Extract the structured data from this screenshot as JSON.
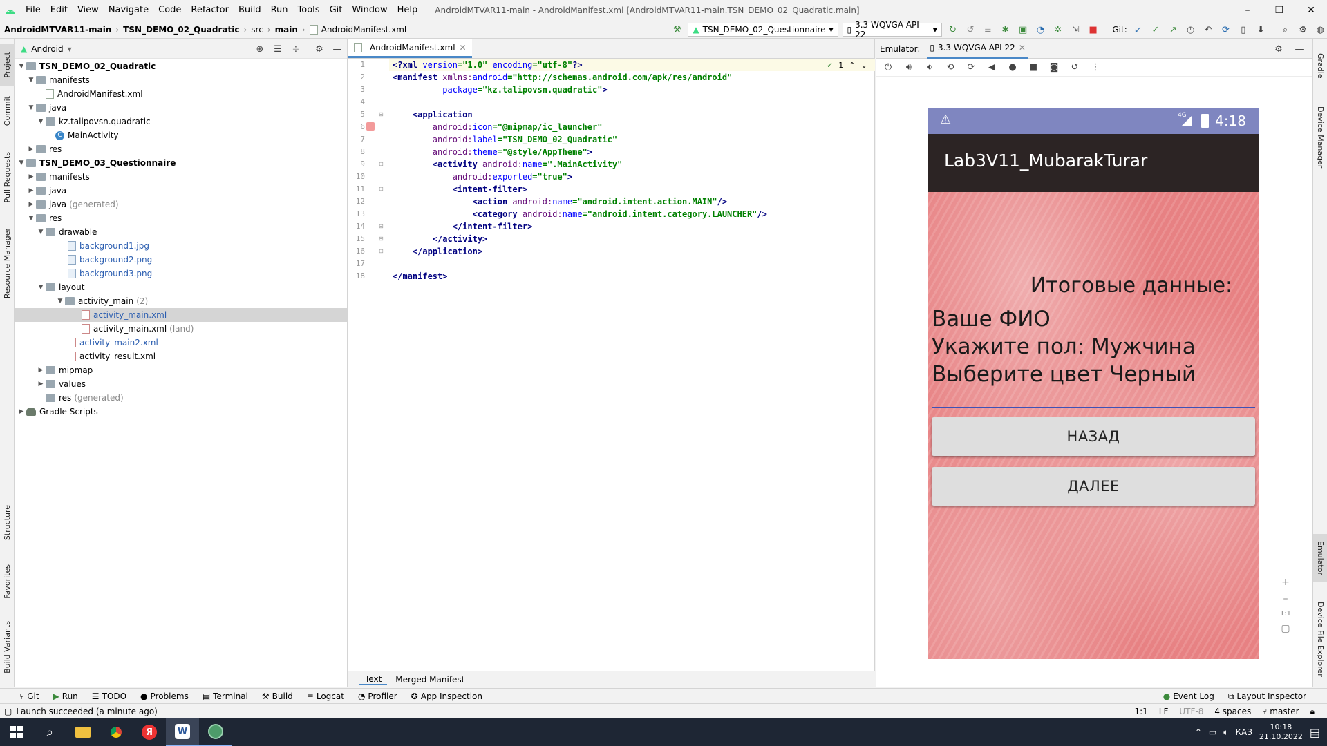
{
  "titlebar": {
    "menu": [
      "File",
      "Edit",
      "View",
      "Navigate",
      "Code",
      "Refactor",
      "Build",
      "Run",
      "Tools",
      "Git",
      "Window",
      "Help"
    ],
    "window_title": "AndroidMTVAR11-main - AndroidManifest.xml [AndroidMTVAR11-main.TSN_DEMO_02_Quadratic.main]",
    "controls": [
      "–",
      "❐",
      "✕"
    ]
  },
  "navbar": {
    "crumbs": [
      "AndroidMTVAR11-main",
      "TSN_DEMO_02_Quadratic",
      "src",
      "main",
      "AndroidManifest.xml"
    ],
    "run_config": "TSN_DEMO_02_Questionnaire",
    "device": "3.3  WQVGA API 22",
    "git_label": "Git:"
  },
  "left_strip": [
    "Project",
    "Commit",
    "Pull Requests",
    "Resource Manager",
    "Structure",
    "Favorites",
    "Build Variants"
  ],
  "right_strip": [
    "Gradle",
    "Device Manager",
    "Emulator",
    "Device File Explorer"
  ],
  "project": {
    "view_mode": "Android",
    "tree": [
      {
        "label": "TSN_DEMO_02_Quadratic",
        "bold": true
      },
      {
        "label": "manifests"
      },
      {
        "label": "AndroidManifest.xml"
      },
      {
        "label": "java"
      },
      {
        "label": "kz.talipovsn.quadratic"
      },
      {
        "label": "MainActivity"
      },
      {
        "label": "res"
      },
      {
        "label": "TSN_DEMO_03_Questionnaire",
        "bold": true
      },
      {
        "label": "manifests"
      },
      {
        "label": "java"
      },
      {
        "label": "java",
        "suffix": "(generated)"
      },
      {
        "label": "res"
      },
      {
        "label": "drawable"
      },
      {
        "label": "background1.jpg"
      },
      {
        "label": "background2.png"
      },
      {
        "label": "background3.png"
      },
      {
        "label": "layout"
      },
      {
        "label": "activity_main",
        "suffix": "(2)"
      },
      {
        "label": "activity_main.xml"
      },
      {
        "label": "activity_main.xml",
        "suffix": "(land)"
      },
      {
        "label": "activity_main2.xml"
      },
      {
        "label": "activity_result.xml"
      },
      {
        "label": "mipmap"
      },
      {
        "label": "values"
      },
      {
        "label": "res",
        "suffix": "(generated)"
      },
      {
        "label": "Gradle Scripts"
      }
    ]
  },
  "editor": {
    "tab": "AndroidManifest.xml",
    "inspection_count": "1",
    "line_numbers": [
      "1",
      "2",
      "3",
      "4",
      "5",
      "6",
      "7",
      "8",
      "9",
      "10",
      "11",
      "12",
      "13",
      "14",
      "15",
      "16",
      "17",
      "18"
    ],
    "bottom_tabs": [
      "Text",
      "Merged Manifest"
    ]
  },
  "emulator": {
    "label": "Emulator:",
    "device_tab": "3.3 WQVGA API 22",
    "status_time": "4:18",
    "network": "4G",
    "app_title": "Lab3V11_MubarakTurar",
    "heading": "Итоговые данные:",
    "lines": [
      "Ваше ФИО",
      "Укажите пол: Мужчина",
      "Выберите цвет Черный"
    ],
    "buttons": [
      "НАЗАД",
      "ДАЛЕЕ"
    ],
    "zoom": [
      "+",
      "–",
      "1:1"
    ],
    "colors": {
      "statusbar": "#7f86c0",
      "appbar": "#2c2424",
      "background": "#e98586"
    }
  },
  "toolwindows": [
    "Git",
    "Run",
    "TODO",
    "Problems",
    "Terminal",
    "Build",
    "Logcat",
    "Profiler",
    "App Inspection"
  ],
  "toolwindows_right": [
    "Event Log",
    "Layout Inspector"
  ],
  "status": {
    "message": "Launch succeeded (a minute ago)",
    "position": "1:1",
    "line_sep": "LF",
    "encoding": "UTF-8",
    "indent": "4 spaces",
    "branch": "master"
  },
  "taskbar": {
    "lang": "КАЗ",
    "time": "10:18",
    "date": "21.10.2022"
  }
}
